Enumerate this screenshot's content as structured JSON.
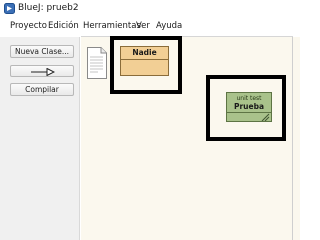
{
  "window": {
    "title": "BlueJ: prueb2"
  },
  "menubar": {
    "items": [
      "Proyecto",
      "Edición",
      "Herramientas",
      "Ver",
      "Ayuda"
    ]
  },
  "toolbar": {
    "new_class_label": "Nueva Clase...",
    "new_arrow_icon": "inheritance-arrow-icon",
    "compile_label": "Compilar"
  },
  "diagram": {
    "readme_icon": "readme-document-icon",
    "classes": [
      {
        "name": "Nadie",
        "stereotype": "",
        "color": "#f2cf95"
      }
    ],
    "tests": [
      {
        "name": "Prueba",
        "stereotype": "unit test",
        "color": "#a9c28b"
      }
    ]
  },
  "colors": {
    "canvas_background": "#fbf8ee",
    "panel_background": "#f0f0f0",
    "highlight_border": "#000000"
  }
}
